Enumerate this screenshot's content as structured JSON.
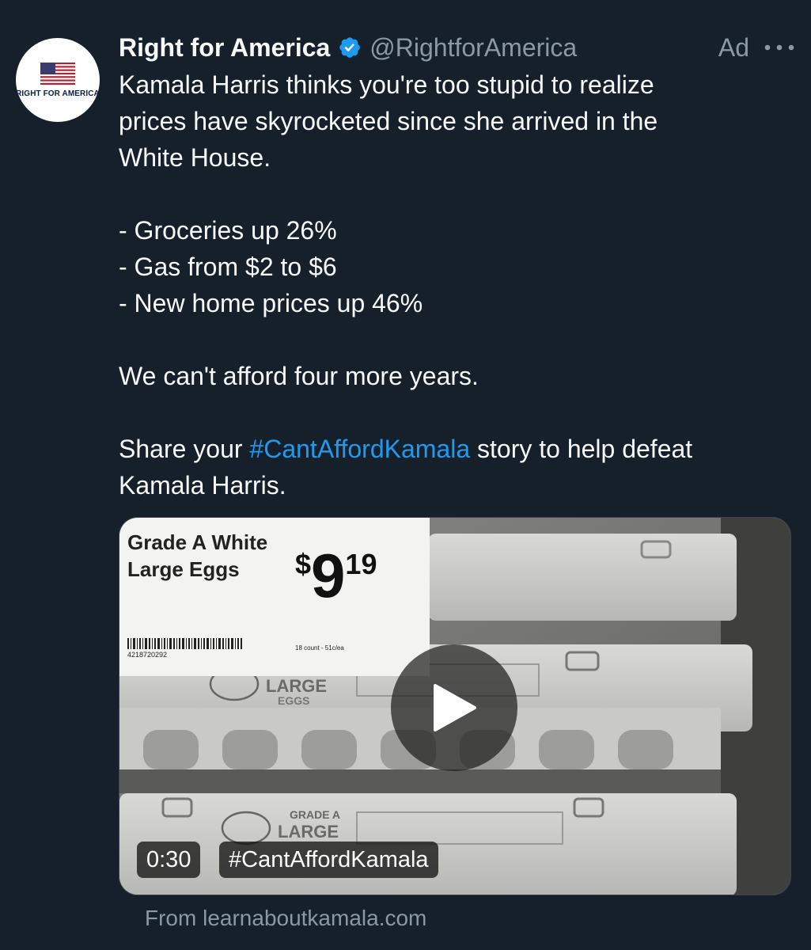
{
  "tweet": {
    "avatar_label": "RIGHT FOR AMERICA",
    "display_name": "Right for America",
    "handle": "@RightforAmerica",
    "ad_label": "Ad",
    "body": {
      "line1": "Kamala Harris thinks you're too stupid to realize",
      "line2": "prices have skyrocketed since she arrived in the",
      "line3": "White House.",
      "bullet1": "- Groceries up 26%",
      "bullet2": "- Gas from $2 to $6",
      "bullet3": "- New home prices up 46%",
      "closing": "We can't afford four more years.",
      "cta_prefix": "Share your ",
      "cta_hashtag": "#CantAffordKamala",
      "cta_suffix": " story to help defeat",
      "cta_line2": "Kamala Harris."
    },
    "media": {
      "duration": "0:30",
      "hashtag_badge": "#CantAffordKamala",
      "shelf_label": {
        "title_line1": "Grade A White",
        "title_line2": "Large Eggs",
        "price_dollar": "$",
        "price_int": "9",
        "price_cents": "19",
        "barcode_number": "4218720292",
        "count": "18 count - 51c/ea"
      },
      "carton_text_1": "GRADE A",
      "carton_text_2": "LARGE",
      "carton_text_3": "EGGS"
    },
    "source": "From learnaboutkamala.com"
  },
  "colors": {
    "background": "#15202b",
    "text_primary": "#f7f9f9",
    "text_secondary": "#8b98a5",
    "link": "#1d9bf0",
    "verified": "#1d9bf0"
  },
  "icons": {
    "verified": "verified-badge-icon",
    "more": "more-horizontal-icon",
    "play": "play-icon",
    "avatar_flag": "us-flag-icon"
  }
}
